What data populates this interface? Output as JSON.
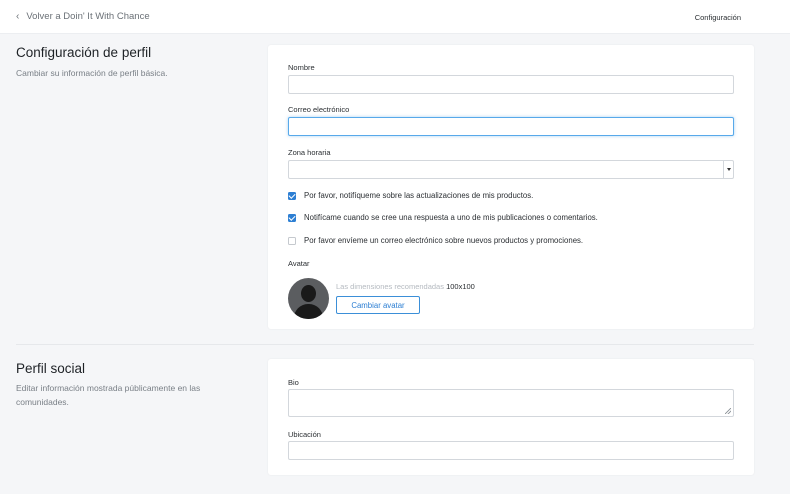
{
  "header": {
    "back_label": "Volver a Doin' It With Chance",
    "right_label": "Configuración"
  },
  "profile": {
    "title": "Configuración de perfil",
    "description": "Cambiar su información de perfil básica.",
    "name_label": "Nombre",
    "name_value": "",
    "email_label": "Correo electrónico",
    "email_value": "",
    "timezone_label": "Zona horaria",
    "timezone_value": "",
    "checkboxes": [
      {
        "label": "Por favor, notifíqueme sobre las actualizaciones de mis productos.",
        "checked": true
      },
      {
        "label": "Notifícame cuando se cree una respuesta a uno de mis publicaciones o comentarios.",
        "checked": true
      },
      {
        "label": "Por favor envíeme un correo electrónico sobre nuevos productos y promociones.",
        "checked": false
      }
    ],
    "avatar_label": "Avatar",
    "avatar_hint": "Las dimensiones recomendadas",
    "avatar_dims": "100x100",
    "avatar_button": "Cambiar avatar"
  },
  "social": {
    "title": "Perfil social",
    "description": "Editar información mostrada públicamente en las comunidades.",
    "bio_label": "Bio",
    "bio_value": "",
    "location_label": "Ubicación",
    "location_value": ""
  },
  "colors": {
    "accent": "#2d7fd3",
    "focus": "#58a9ea",
    "background": "#f5f6f8"
  },
  "icons": {
    "back": "chevron-left-icon",
    "select": "chevron-down-icon",
    "avatar": "user-silhouette-icon"
  }
}
